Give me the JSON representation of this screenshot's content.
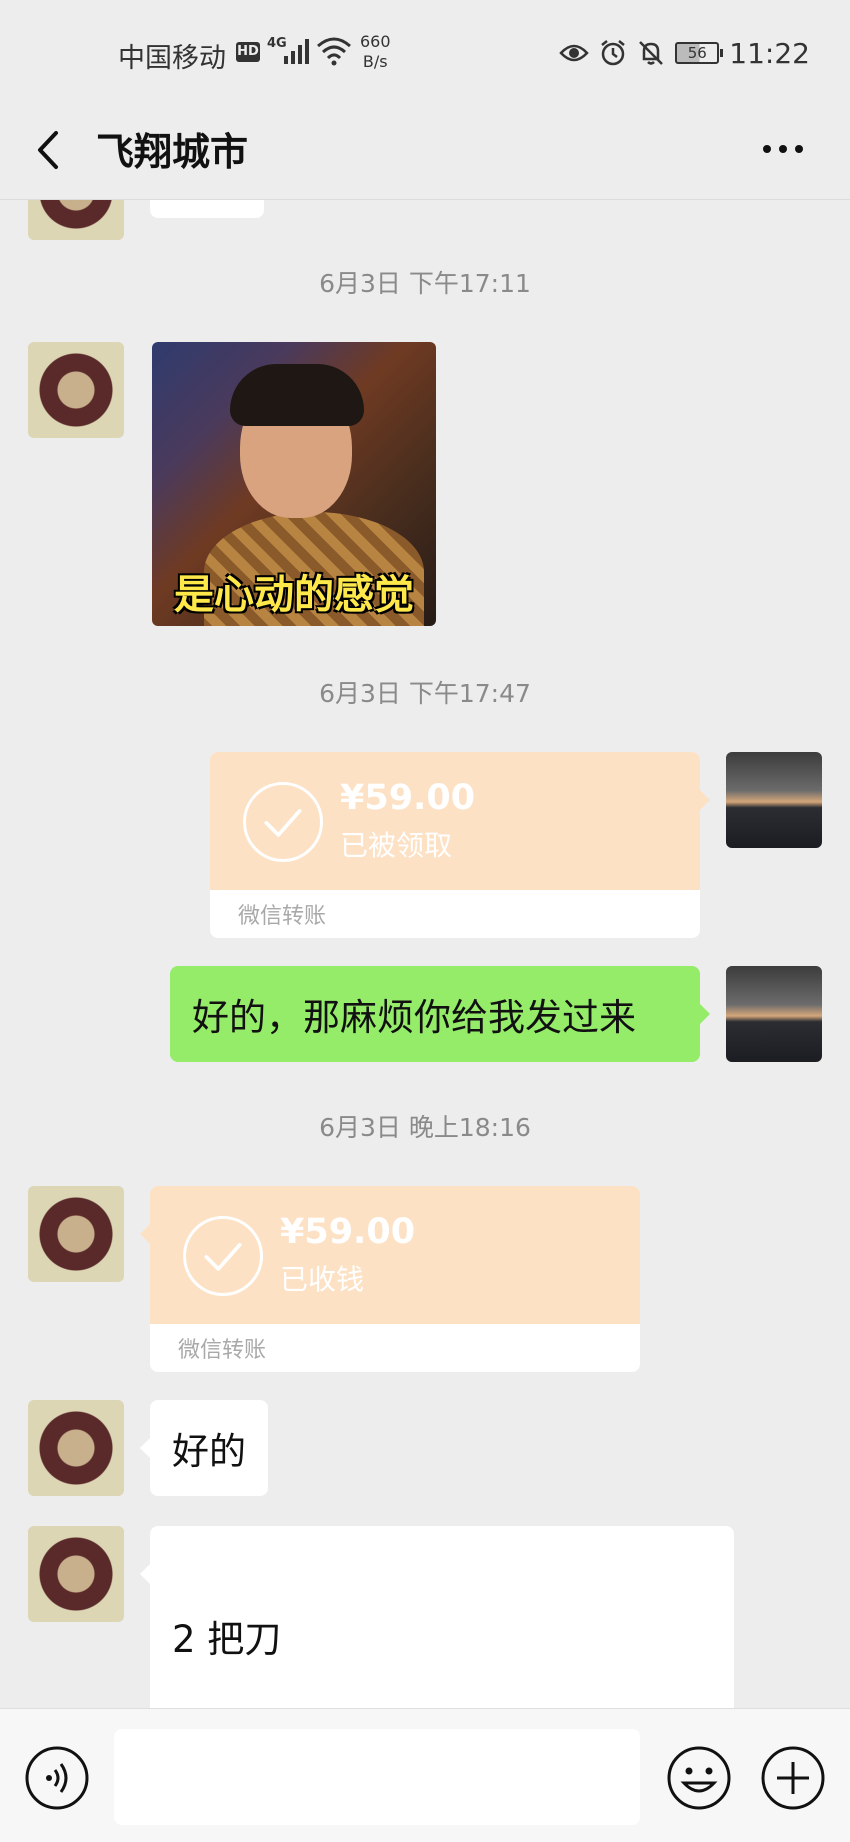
{
  "status_bar": {
    "carrier": "中国移动",
    "hd": "HD",
    "network": "4G",
    "speed_value": "660",
    "speed_unit": "B/s",
    "battery": "56",
    "time": "11:22"
  },
  "header": {
    "title": "飞翔城市"
  },
  "messages": {
    "ts1": "6月3日 下午17:11",
    "sticker_caption": "是心动的感觉",
    "ts2": "6月3日 下午17:47",
    "transfer1": {
      "amount": "¥59.00",
      "status": "已被领取",
      "footer": "微信转账"
    },
    "reply1": "好的，那麻烦你给我发过来",
    "ts3": "6月3日 晚上18:16",
    "transfer2": {
      "amount": "¥59.00",
      "status": "已收钱",
      "footer": "微信转账"
    },
    "reply2": "好的",
    "reply3": "2 把刀"
  },
  "colors": {
    "background": "#ededed",
    "bubble_self": "#95ec69",
    "bubble_other": "#ffffff",
    "transfer": "#fde1c5"
  },
  "icons": [
    "back-arrow-icon",
    "more-icon",
    "voice-icon",
    "emoji-icon",
    "plus-icon",
    "eye-icon",
    "alarm-icon",
    "bell-off-icon",
    "wifi-icon",
    "signal-icon"
  ]
}
